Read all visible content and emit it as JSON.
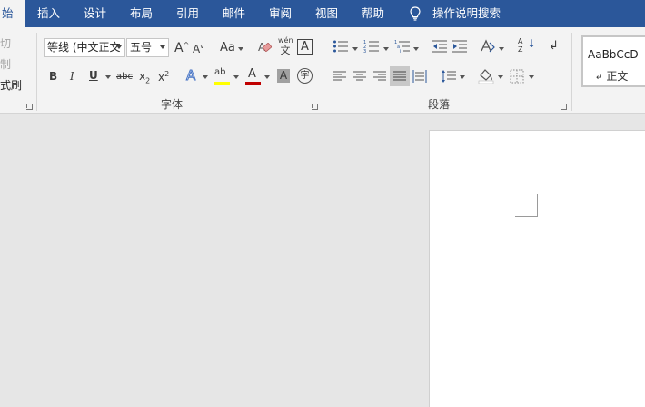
{
  "tabs": [
    {
      "label": "始",
      "active": true
    },
    {
      "label": "插入"
    },
    {
      "label": "设计"
    },
    {
      "label": "布局"
    },
    {
      "label": "引用"
    },
    {
      "label": "邮件"
    },
    {
      "label": "审阅"
    },
    {
      "label": "视图"
    },
    {
      "label": "帮助"
    }
  ],
  "search": {
    "label": "操作说明搜索",
    "icon": "lightbulb-icon"
  },
  "clipboard": {
    "cut": "切",
    "copy": "制",
    "format_painter": "式刷"
  },
  "font": {
    "group_label": "字体",
    "font_name": "等线 (中文正文",
    "font_size": "五号",
    "grow_label": "A",
    "shrink_label": "A",
    "case_label": "Aa",
    "phonetic_top": "wén",
    "phonetic_bottom": "文",
    "border_char": "A",
    "bold": "B",
    "italic": "I",
    "underline": "U",
    "strike": "abc",
    "subscript": "x",
    "subscript_mark": "2",
    "superscript": "x",
    "superscript_mark": "2",
    "effects": "A",
    "highlight": "ab",
    "font_color": "A",
    "shading_char": "A",
    "enclose_char": "字"
  },
  "paragraph": {
    "group_label": "段落",
    "sort_top": "A",
    "sort_bottom": "Z"
  },
  "styles": {
    "sample": "AaBbCcD",
    "name": "正文",
    "mark": "↵"
  },
  "colors": {
    "tab_bar": "#2b579a",
    "ribbon": "#f3f3f3",
    "highlight_yellow": "#ffff00",
    "font_color_red": "#c00000",
    "effects_blue": "#4472c4",
    "document_bg": "#e6e6e6"
  }
}
